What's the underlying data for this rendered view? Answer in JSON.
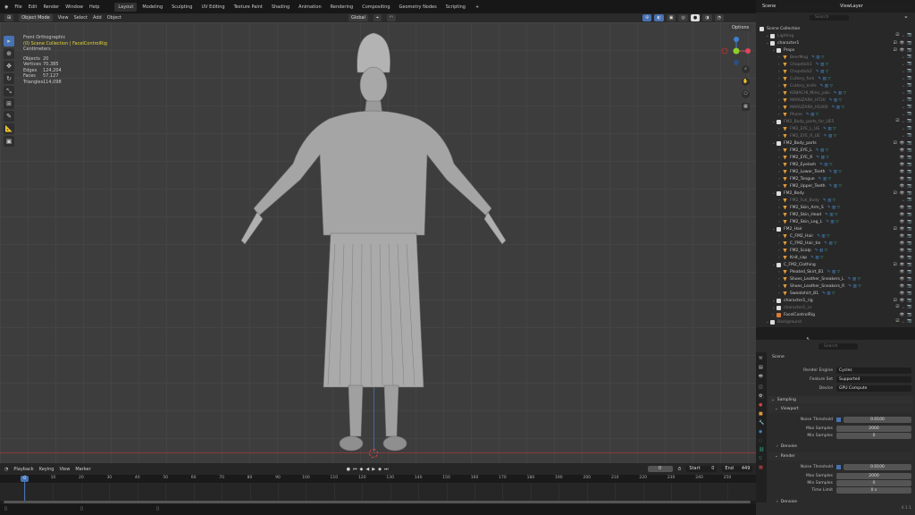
{
  "menu": [
    "File",
    "Edit",
    "Render",
    "Window",
    "Help"
  ],
  "workspaces": [
    "Layout",
    "Modeling",
    "Sculpting",
    "UV Editing",
    "Texture Paint",
    "Shading",
    "Animation",
    "Rendering",
    "Compositing",
    "Geometry Nodes",
    "Scripting"
  ],
  "active_workspace": "Layout",
  "viewport_header": {
    "mode": "Object Mode",
    "menus": [
      "View",
      "Select",
      "Add",
      "Object"
    ],
    "orientation": "Global",
    "options": "Options"
  },
  "overlay_info": {
    "view": "Front Orthographic",
    "collection": "(0) Scene Collection | FacelControlRig",
    "units": "Centimeters",
    "stats": [
      [
        "Objects",
        "20"
      ],
      [
        "Vertices",
        "70,385"
      ],
      [
        "Edges",
        "124,204"
      ],
      [
        "Faces",
        "57,127"
      ],
      [
        "Triangles",
        "114,098"
      ]
    ]
  },
  "gizmo": {
    "x": "X",
    "y": "Y",
    "z": "Z",
    "colors": {
      "x": "#e0455a",
      "y": "#8ccf2a",
      "z": "#3f7fd0"
    }
  },
  "right_header": {
    "scene": "Scene",
    "view_layer": "ViewLayer",
    "search_placeholder": "Search"
  },
  "outliner": [
    {
      "label": "Scene Collection",
      "lvl": 0,
      "type": "col"
    },
    {
      "label": "Lighting",
      "lvl": 1,
      "type": "col",
      "dim": true
    },
    {
      "label": "character1",
      "lvl": 1,
      "type": "col"
    },
    {
      "label": "Props",
      "lvl": 2,
      "type": "col"
    },
    {
      "label": "BeerMug",
      "lvl": 3,
      "type": "obj",
      "dim": true
    },
    {
      "label": "Chopstick1",
      "lvl": 3,
      "type": "obj",
      "dim": true
    },
    {
      "label": "Chopstick2",
      "lvl": 3,
      "type": "obj",
      "dim": true
    },
    {
      "label": "Cutlery_fork",
      "lvl": 3,
      "type": "obj",
      "dim": true
    },
    {
      "label": "Cutlery_knife",
      "lvl": 3,
      "type": "obj",
      "dim": true
    },
    {
      "label": "KOBACHI_Mino_yaki",
      "lvl": 3,
      "type": "obj",
      "dim": true
    },
    {
      "label": "MARUZARA_H720",
      "lvl": 3,
      "type": "obj",
      "dim": true
    },
    {
      "label": "MARUZARA_H1000",
      "lvl": 3,
      "type": "obj",
      "dim": true
    },
    {
      "label": "Phone",
      "lvl": 3,
      "type": "obj",
      "dim": true
    },
    {
      "label": "FM2_Body_parts_for_UE5",
      "lvl": 2,
      "type": "col",
      "dim": true
    },
    {
      "label": "FM2_EYE_L_UE",
      "lvl": 3,
      "type": "obj",
      "dim": true
    },
    {
      "label": "FM2_EYE_R_UE",
      "lvl": 3,
      "type": "obj",
      "dim": true
    },
    {
      "label": "FM2_Body_parts",
      "lvl": 2,
      "type": "col"
    },
    {
      "label": "FM2_EYE_L",
      "lvl": 3,
      "type": "obj"
    },
    {
      "label": "FM2_EYE_R",
      "lvl": 3,
      "type": "obj"
    },
    {
      "label": "FM2_Eyelash",
      "lvl": 3,
      "type": "obj"
    },
    {
      "label": "FM2_Lower_Teeth",
      "lvl": 3,
      "type": "obj"
    },
    {
      "label": "FM2_Tongue",
      "lvl": 3,
      "type": "obj"
    },
    {
      "label": "FM2_Upper_Teeth",
      "lvl": 3,
      "type": "obj"
    },
    {
      "label": "FM2_Body",
      "lvl": 2,
      "type": "col"
    },
    {
      "label": "FM2_Full_Body",
      "lvl": 3,
      "type": "obj",
      "dim": true
    },
    {
      "label": "FM2_Skin_Arm_S",
      "lvl": 3,
      "type": "obj"
    },
    {
      "label": "FM2_Skin_Head",
      "lvl": 3,
      "type": "obj"
    },
    {
      "label": "FM2_Skin_Leg_L",
      "lvl": 3,
      "type": "obj"
    },
    {
      "label": "FM2_Hair",
      "lvl": 2,
      "type": "col"
    },
    {
      "label": "C_FM2_Hair",
      "lvl": 3,
      "type": "obj"
    },
    {
      "label": "C_FM2_Hair_tie",
      "lvl": 3,
      "type": "obj"
    },
    {
      "label": "FM2_Scalp",
      "lvl": 3,
      "type": "obj"
    },
    {
      "label": "Knit_cap",
      "lvl": 3,
      "type": "obj"
    },
    {
      "label": "C_FM2_Clothing",
      "lvl": 2,
      "type": "col"
    },
    {
      "label": "Pleated_Skirt_B1",
      "lvl": 3,
      "type": "obj"
    },
    {
      "label": "Shoes_Leather_Sneakers_L",
      "lvl": 3,
      "type": "obj"
    },
    {
      "label": "Shoes_Leather_Sneakers_R",
      "lvl": 3,
      "type": "obj"
    },
    {
      "label": "Sweatshirt_B1",
      "lvl": 3,
      "type": "obj"
    },
    {
      "label": "character1_rig",
      "lvl": 2,
      "type": "col"
    },
    {
      "label": "character1_cs",
      "lvl": 2,
      "type": "col",
      "dim": true
    },
    {
      "label": "FacelControlRig",
      "lvl": 2,
      "type": "rig"
    },
    {
      "label": "Background",
      "lvl": 1,
      "type": "col",
      "dim": true
    }
  ],
  "properties": {
    "search_placeholder": "Search",
    "context": "Scene",
    "render_engine": {
      "label": "Render Engine",
      "value": "Cycles"
    },
    "feature_set": {
      "label": "Feature Set",
      "value": "Supported"
    },
    "device": {
      "label": "Device",
      "value": "GPU Compute"
    },
    "sampling": "Sampling",
    "viewport": "Viewport",
    "render": "Render",
    "denoise": "Denoise",
    "noise_threshold": {
      "label": "Noise Threshold",
      "value": "0.0100"
    },
    "max_samples": {
      "label": "Max Samples",
      "viewport": "2000",
      "render": "2000"
    },
    "min_samples": {
      "label": "Min Samples",
      "viewport": "0",
      "render": "0"
    },
    "time_limit": {
      "label": "Time Limit",
      "value": "0 s"
    }
  },
  "timeline": {
    "menus": [
      "Playback",
      "Keying",
      "View",
      "Marker"
    ],
    "current_frame": "0",
    "start_label": "Start",
    "start": "0",
    "end_label": "End",
    "end": "449",
    "ticks": [
      "0",
      "10",
      "20",
      "30",
      "40",
      "50",
      "60",
      "70",
      "80",
      "90",
      "100",
      "110",
      "120",
      "130",
      "140",
      "150",
      "160",
      "170",
      "180",
      "190",
      "200",
      "210",
      "220",
      "230",
      "240",
      "250"
    ]
  },
  "version": "4.1.1"
}
